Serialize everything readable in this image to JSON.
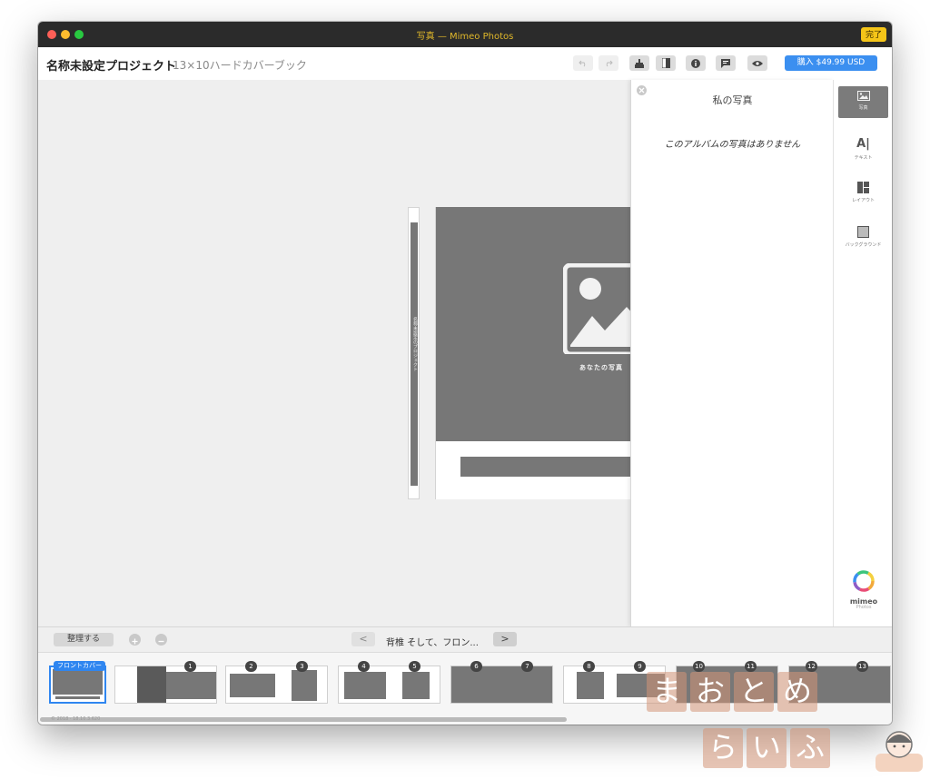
{
  "window": {
    "title": "写真 — Mimeo Photos",
    "done_label": "完了"
  },
  "toolbar": {
    "project_name": "名称未設定プロジェクト",
    "project_subtitle": "13×10ハードカバーブック",
    "buttons": [
      "undo-icon",
      "redo-icon",
      "cleanup-icon",
      "cover-icon",
      "info-icon",
      "comment-icon",
      "preview-eye-icon"
    ],
    "buy_label": "購入 $49.99 USD"
  },
  "canvas": {
    "spine_text": "名称未設定のプロジェクト",
    "placeholder_label": "あなたの写真"
  },
  "photos_panel": {
    "title": "私の写真",
    "empty_message": "このアルバムの写真はありません"
  },
  "sidebar": {
    "items": [
      {
        "label": "写真",
        "icon": "photo-icon",
        "active": true
      },
      {
        "label": "テキスト",
        "icon": "text-icon",
        "active": false
      },
      {
        "label": "レイアウト",
        "icon": "layout-icon",
        "active": false
      },
      {
        "label": "バックグラウンド",
        "icon": "background-icon",
        "active": false
      }
    ],
    "brand_name": "mimeo",
    "brand_sub": "Photos"
  },
  "bottom": {
    "organize_label": "整理する",
    "page_label": "背椎 そして、フロン...",
    "prev_glyph": "<",
    "next_glyph": ">"
  },
  "thumbnails": {
    "cover_label": "フロントカバー",
    "page_numbers": [
      "1",
      "2",
      "3",
      "4",
      "5",
      "6",
      "7",
      "8",
      "9",
      "10",
      "11",
      "12",
      "13"
    ]
  },
  "footer": {
    "version": "© 2018 · 18.10.3.620"
  },
  "watermark": {
    "chars_top": [
      "ま",
      "お",
      "と",
      "め"
    ],
    "chars_bottom": [
      "ら",
      "い",
      "ふ"
    ]
  },
  "colors": {
    "accent": "#3b8ff0",
    "done_yellow": "#f5c518",
    "title_text": "#e0b82a",
    "placeholder_gray": "#777777"
  }
}
